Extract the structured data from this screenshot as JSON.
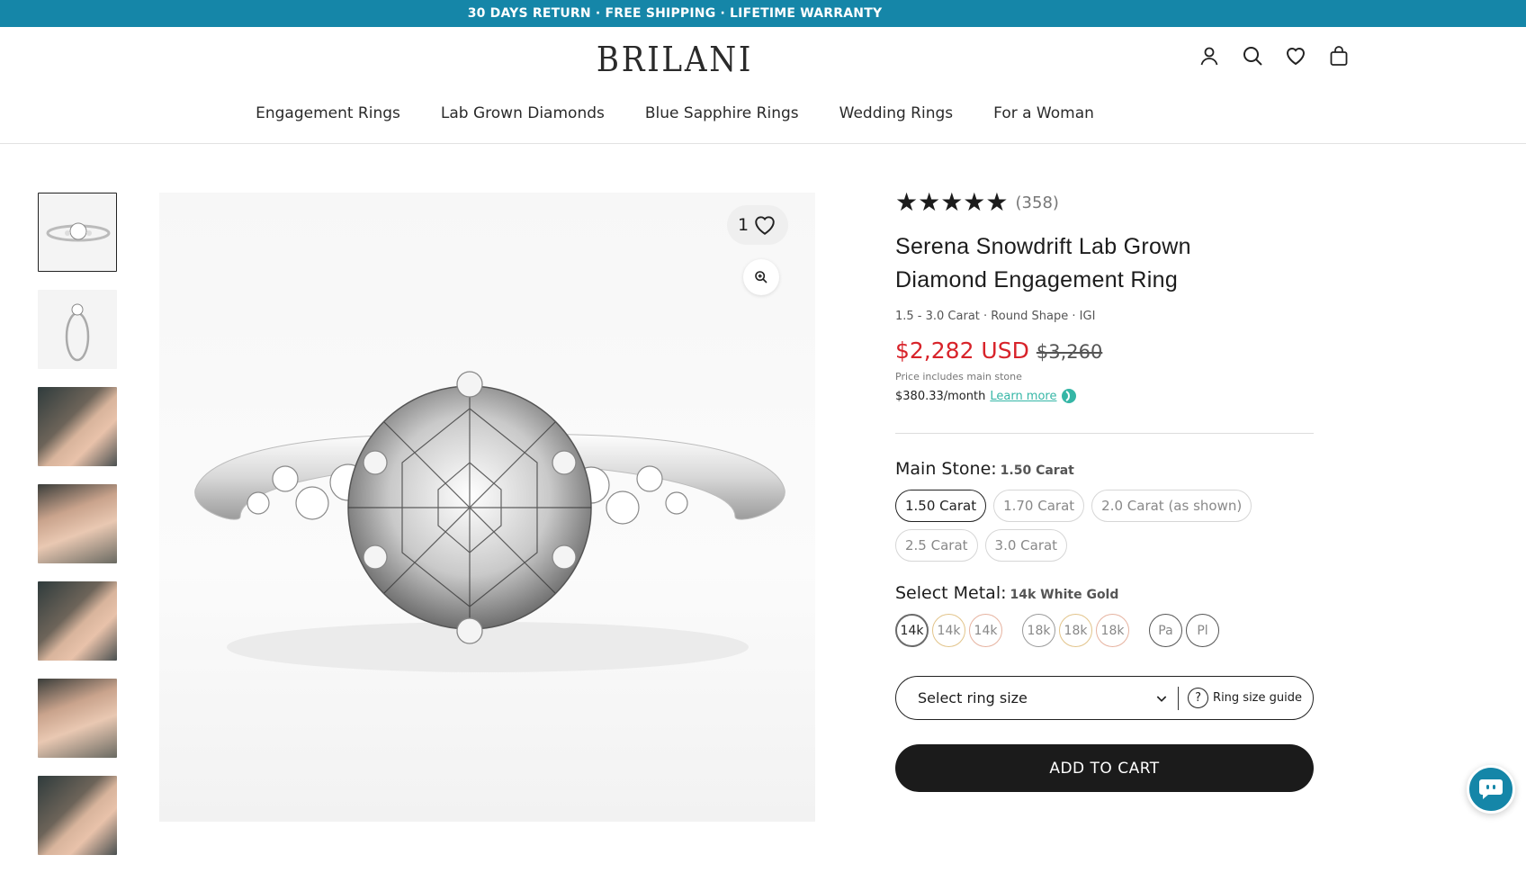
{
  "announcement": "30 DAYS RETURN · FREE SHIPPING · LIFETIME WARRANTY",
  "brand": "BRILANI",
  "header_icons": [
    "account-icon",
    "search-icon",
    "wishlist-icon",
    "bag-icon"
  ],
  "nav": [
    "Engagement Rings",
    "Lab Grown Diamonds",
    "Blue Sapphire Rings",
    "Wedding Rings",
    "For a Woman"
  ],
  "gallery": {
    "likes": "1",
    "thumb_count": 7
  },
  "product": {
    "rating_stars": "★★★★★",
    "rating_count": "(358)",
    "title_line1": "Serena Snowdrift Lab Grown",
    "title_line2": "Diamond Engagement Ring",
    "specs": "1.5 - 3.0 Carat · Round Shape · IGI",
    "price": "$2,282 USD",
    "compare_price": "$3,260",
    "price_note": "Price includes main stone",
    "monthly": "$380.33/month",
    "learn_more": "Learn more"
  },
  "main_stone": {
    "label": "Main Stone:",
    "selected": "1.50 Carat",
    "options": [
      "1.50 Carat",
      "1.70 Carat",
      "2.0 Carat (as shown)",
      "2.5 Carat",
      "3.0 Carat"
    ]
  },
  "metal": {
    "label": "Select Metal:",
    "selected": "14k White Gold",
    "options": [
      {
        "text": "14k",
        "color": "#9a9a9a"
      },
      {
        "text": "14k",
        "color": "#e2c48a"
      },
      {
        "text": "14k",
        "color": "#e6b3a0"
      },
      {
        "text": "18k",
        "color": "#9a9a9a"
      },
      {
        "text": "18k",
        "color": "#e2c48a"
      },
      {
        "text": "18k",
        "color": "#e6b3a0"
      },
      {
        "text": "Pa",
        "color": "#555555"
      },
      {
        "text": "Pl",
        "color": "#555555"
      }
    ]
  },
  "ring_size": {
    "placeholder": "Select ring size",
    "guide": "Ring size guide"
  },
  "add_to_cart": "ADD TO CART",
  "colors": {
    "topbar": "#1586a8",
    "price": "#d8232a",
    "link": "#35b6a6",
    "cart": "#1b1b1b"
  }
}
